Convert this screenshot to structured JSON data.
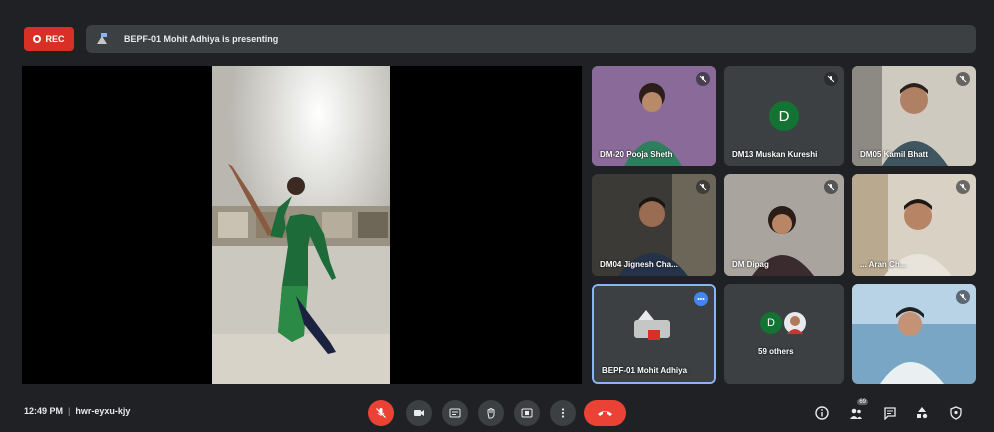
{
  "topbar": {
    "rec_label": "REC",
    "presenting_text": "BEPF-01 Mohit Adhiya is presenting"
  },
  "participants": [
    {
      "name": "DM-20 Pooja Sheth"
    },
    {
      "name": "DM13 Muskan Kureshi",
      "initial": "D"
    },
    {
      "name": "DM05 Kamil Bhatt"
    },
    {
      "name": "DM04 Jignesh Cha..."
    },
    {
      "name": "DM Dipag"
    },
    {
      "name": "... Aran Ch..."
    },
    {
      "name": "BEPF-01 Mohit Adhiya"
    },
    {
      "name": "59 others",
      "initial": "D"
    },
    {
      "name": ""
    }
  ],
  "bottombar": {
    "time": "12:49 PM",
    "separator": "|",
    "meeting_code": "hwr-eyxu-kjy",
    "people_count": "69"
  },
  "colors": {
    "background": "#202124",
    "tile": "#3c4043",
    "danger": "#ea4335",
    "avatar": "#137333",
    "accent": "#4285f4"
  }
}
